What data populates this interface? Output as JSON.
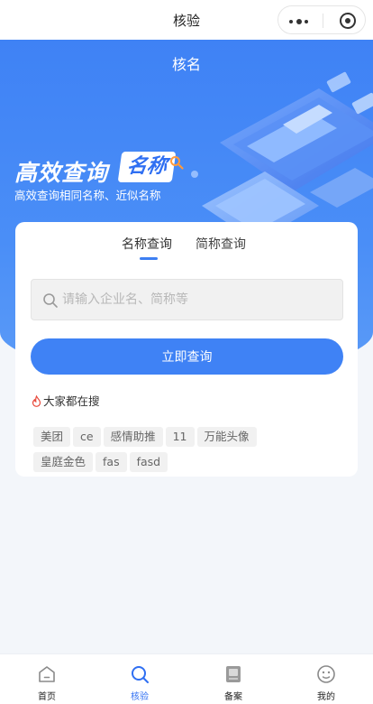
{
  "topbar": {
    "title": "核验",
    "capsule": {
      "menu_icon": "more-dots-icon",
      "close_icon": "target-close-icon"
    }
  },
  "hero": {
    "title": "核名",
    "big_text": "高效查询",
    "badge_text": "名称",
    "subtitle": "高效查询相同名称、近似名称"
  },
  "search": {
    "tabs": [
      {
        "label": "名称查询",
        "active": true
      },
      {
        "label": "简称查询",
        "active": false
      }
    ],
    "placeholder": "请输入企业名、简称等",
    "value": "",
    "button_label": "立即查询"
  },
  "hot": {
    "title": "大家都在搜",
    "tags": [
      "美团",
      "ce",
      "感情助推",
      "11",
      "万能头像",
      "皇庭金色",
      "fas",
      "fasd"
    ]
  },
  "tabbar": {
    "items": [
      {
        "label": "首页",
        "icon": "home-icon",
        "active": false
      },
      {
        "label": "核验",
        "icon": "search-icon",
        "active": true
      },
      {
        "label": "备案",
        "icon": "record-icon",
        "active": false
      },
      {
        "label": "我的",
        "icon": "profile-icon",
        "active": false
      }
    ]
  },
  "colors": {
    "primary": "#3f82f5",
    "background": "#f3f6fa",
    "tag_bg": "#f1f1f1"
  }
}
